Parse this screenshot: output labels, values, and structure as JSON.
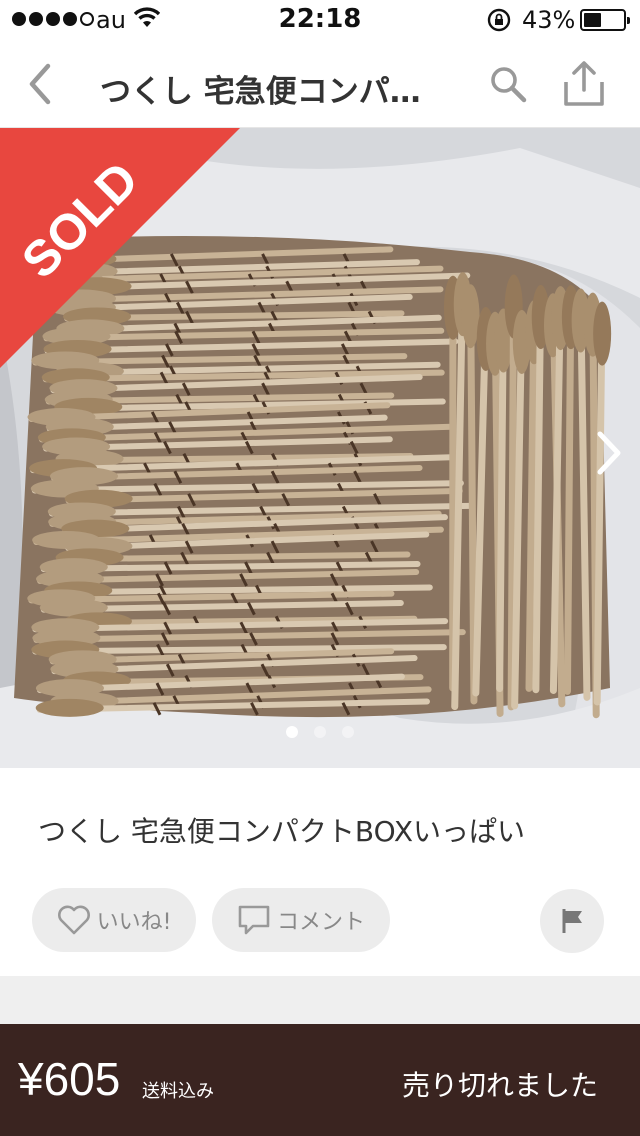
{
  "status_bar": {
    "carrier": "au",
    "time": "22:18",
    "battery_percent": "43%",
    "battery_level": 0.43,
    "signal_bars_filled": 4,
    "signal_bars_total": 5
  },
  "nav": {
    "title": "つくし 宅急便コンパ…",
    "icons": [
      "chevron-left-icon",
      "search-icon",
      "share-icon"
    ]
  },
  "photo": {
    "sold_label": "SOLD",
    "sold_banner_color": "#e8473f",
    "page_count": 3,
    "current_page": 1
  },
  "item": {
    "title": "つくし 宅急便コンパクトBOXいっぱい"
  },
  "actions": {
    "like_label": "いいね!",
    "comment_label": "コメント"
  },
  "footer": {
    "price": "¥605",
    "shipping_note": "送料込み",
    "status_label": "売り切れました",
    "background_color": "#3a2420"
  }
}
